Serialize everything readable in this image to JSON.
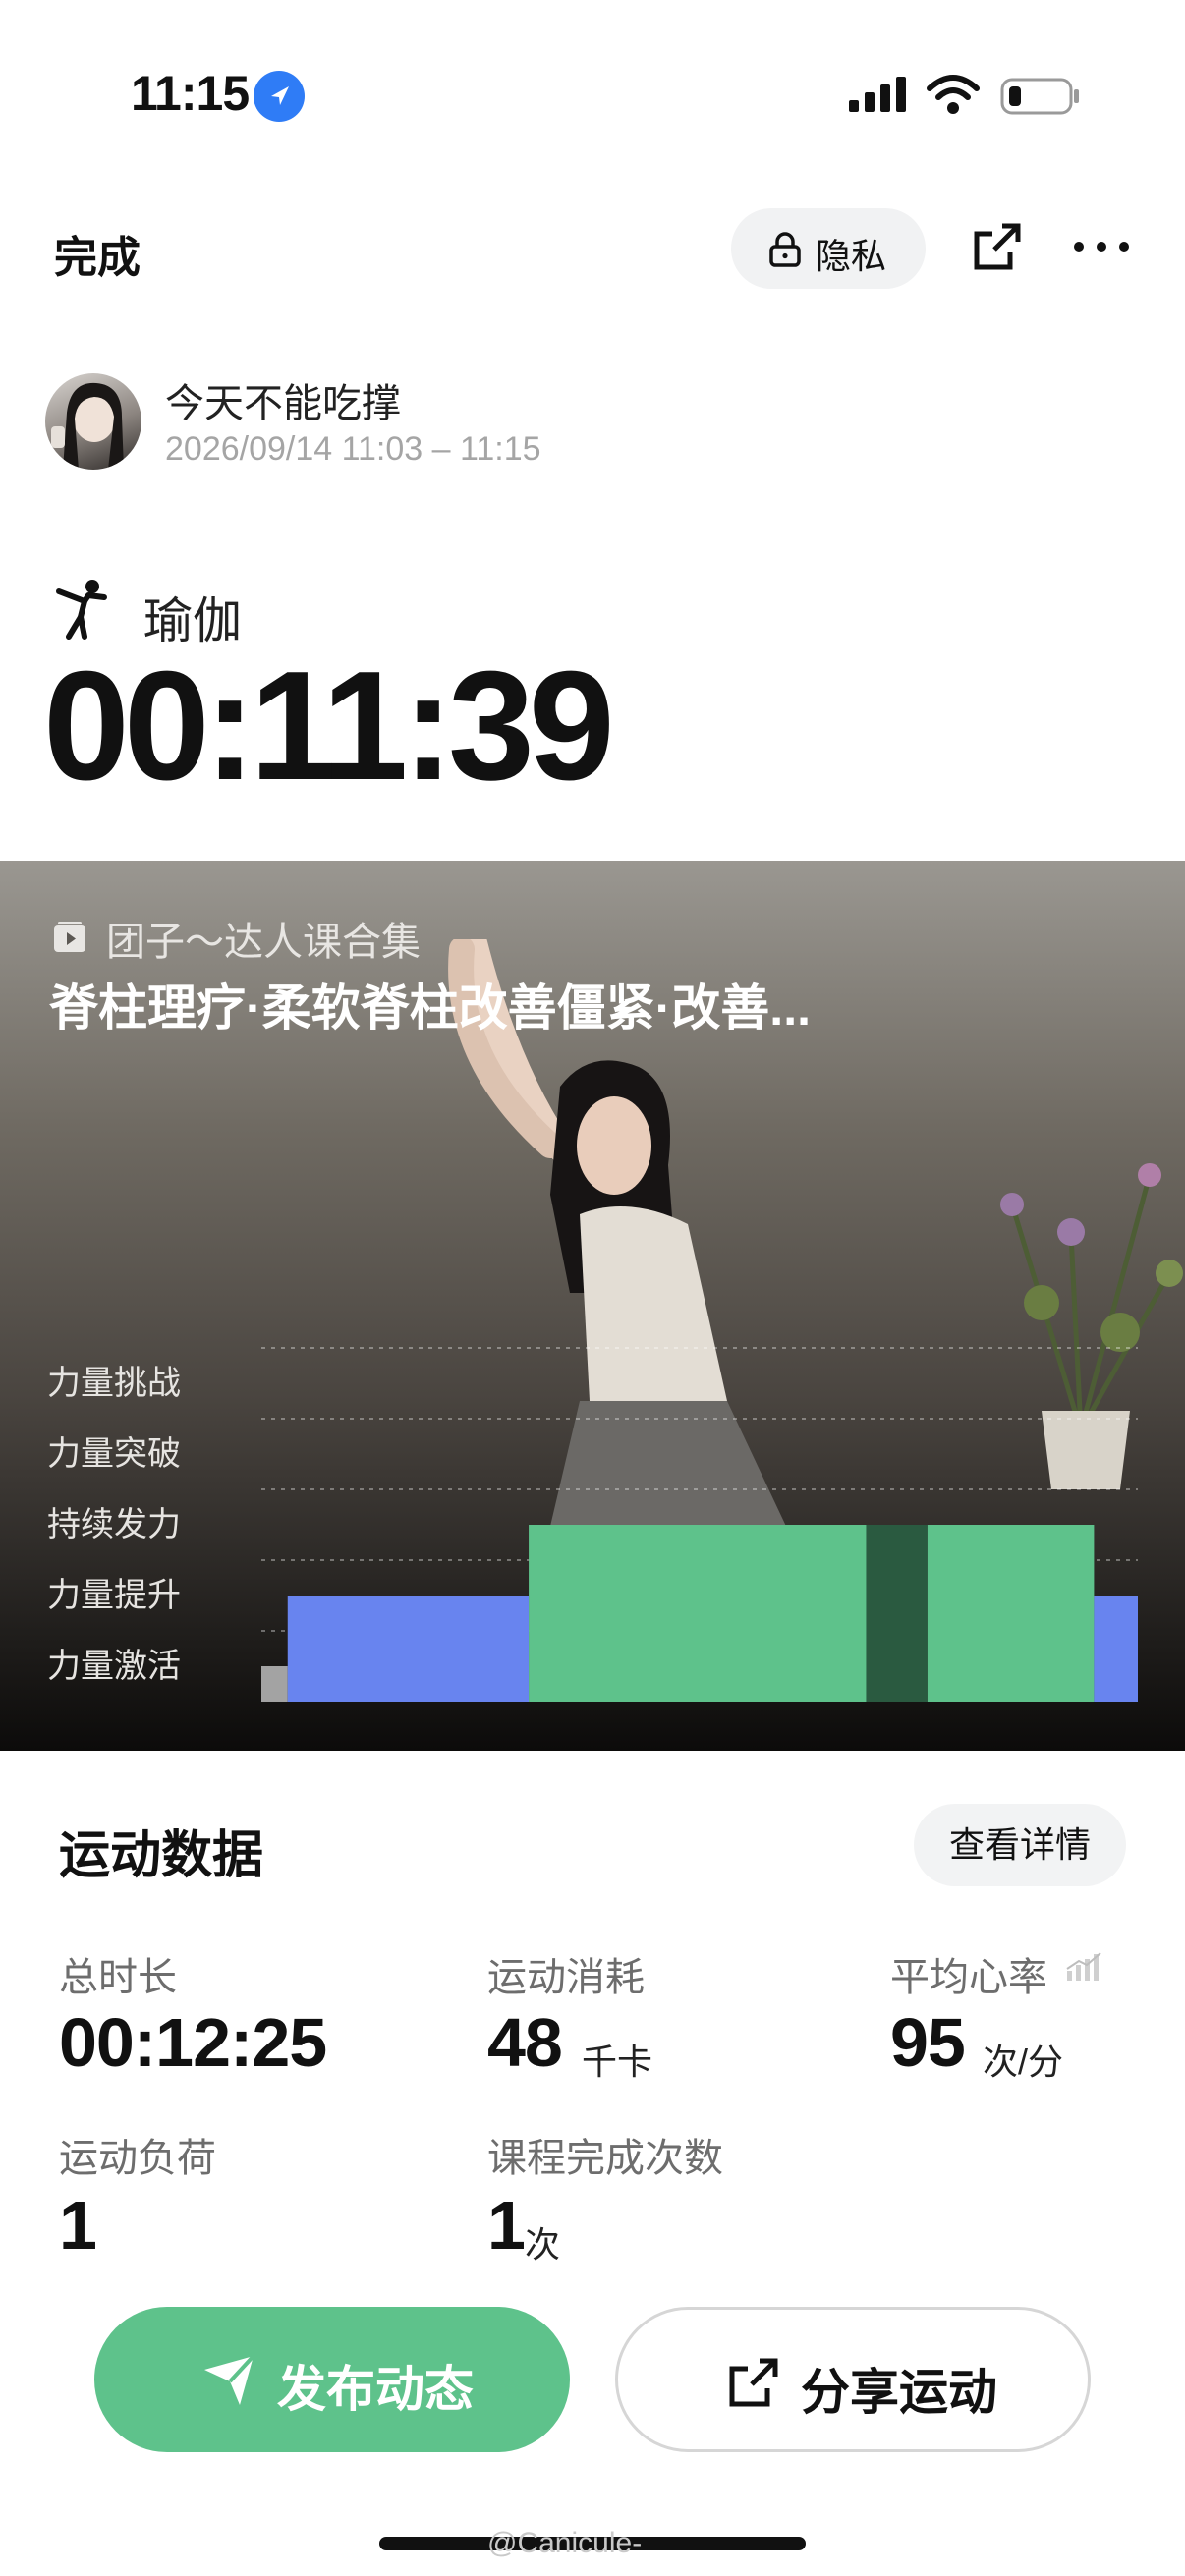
{
  "status_bar": {
    "time": "11:15"
  },
  "header": {
    "done_label": "完成",
    "privacy_label": "隐私"
  },
  "user": {
    "name": "今天不能吃撑",
    "session_time": "2026/09/14 11:03 – 11:15"
  },
  "activity": {
    "name": "瑜伽",
    "duration": "00:11:39"
  },
  "course": {
    "series": "团子～达人课合集",
    "title": "脊柱理疗·柔软脊柱改善僵紧·改善..."
  },
  "intensity": {
    "levels": [
      "力量挑战",
      "力量突破",
      "持续发力",
      "力量提升",
      "力量激活"
    ],
    "segments": [
      {
        "level": 0,
        "share": 0.03,
        "color": "#a3a3a3"
      },
      {
        "level": 1,
        "share": 0.275,
        "color": "#6884ef"
      },
      {
        "level": 2,
        "share": 0.385,
        "color": "#5ec28b"
      },
      {
        "level": 2,
        "share": 0.07,
        "color": "#2a5a40"
      },
      {
        "level": 2,
        "share": 0.19,
        "color": "#5ec28b"
      },
      {
        "level": 1,
        "share": 0.05,
        "color": "#6884ef"
      }
    ]
  },
  "stats": {
    "title": "运动数据",
    "detail_button": "查看详情",
    "total_duration": {
      "label": "总时长",
      "value": "00:12:25"
    },
    "calories": {
      "label": "运动消耗",
      "value": "48",
      "unit": "千卡"
    },
    "heart_rate": {
      "label": "平均心率",
      "value": "95",
      "unit": "次/分"
    },
    "load": {
      "label": "运动负荷",
      "value": "1"
    },
    "completions": {
      "label": "课程完成次数",
      "value": "1",
      "unit": "次"
    }
  },
  "actions": {
    "post_label": "发布动态",
    "share_label": "分享运动"
  },
  "watermark": "@Canicule-",
  "colors": {
    "accent_green": "#5ec28b",
    "accent_blue": "#6884ef",
    "location_blue": "#2f7cf6"
  }
}
